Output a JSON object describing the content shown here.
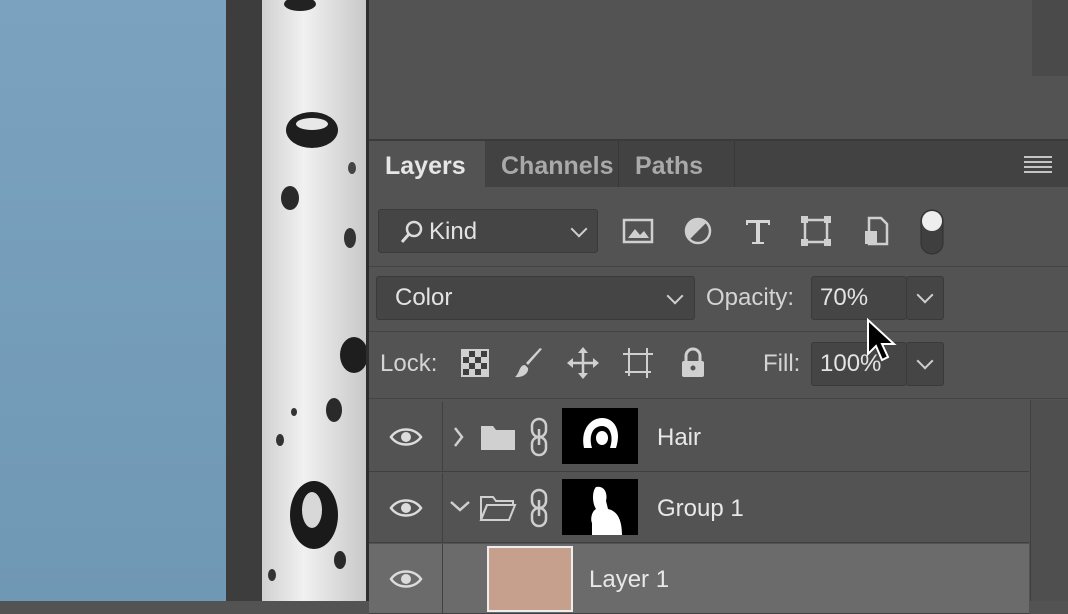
{
  "tabs": [
    {
      "label": "Layers",
      "active": true
    },
    {
      "label": "Channels",
      "active": false
    },
    {
      "label": "Paths",
      "active": false
    }
  ],
  "filter": {
    "kind_label": "Kind"
  },
  "filter_icons": [
    "image-filter-icon",
    "adjustment-filter-icon",
    "type-filter-icon",
    "shape-filter-icon",
    "smart-object-filter-icon",
    "filter-toggle-icon"
  ],
  "blend": {
    "mode": "Color"
  },
  "opacity": {
    "label": "Opacity:",
    "value": "70%"
  },
  "lock": {
    "label": "Lock:"
  },
  "lock_icons": [
    "lock-transparent-pixels-icon",
    "lock-image-pixels-icon",
    "lock-position-icon",
    "lock-artboard-icon",
    "lock-all-icon"
  ],
  "fill": {
    "label": "Fill:",
    "value": "100%"
  },
  "layers": [
    {
      "name": "Hair",
      "type": "group",
      "expanded": false
    },
    {
      "name": "Group 1",
      "type": "group",
      "expanded": true
    },
    {
      "name": "Layer 1",
      "type": "pixel",
      "thumb_color": "#c6a08c"
    }
  ],
  "colors": {
    "panel_bg": "#535353",
    "tab_bar": "#424242",
    "canvas_blue": "#7ba3bf"
  }
}
